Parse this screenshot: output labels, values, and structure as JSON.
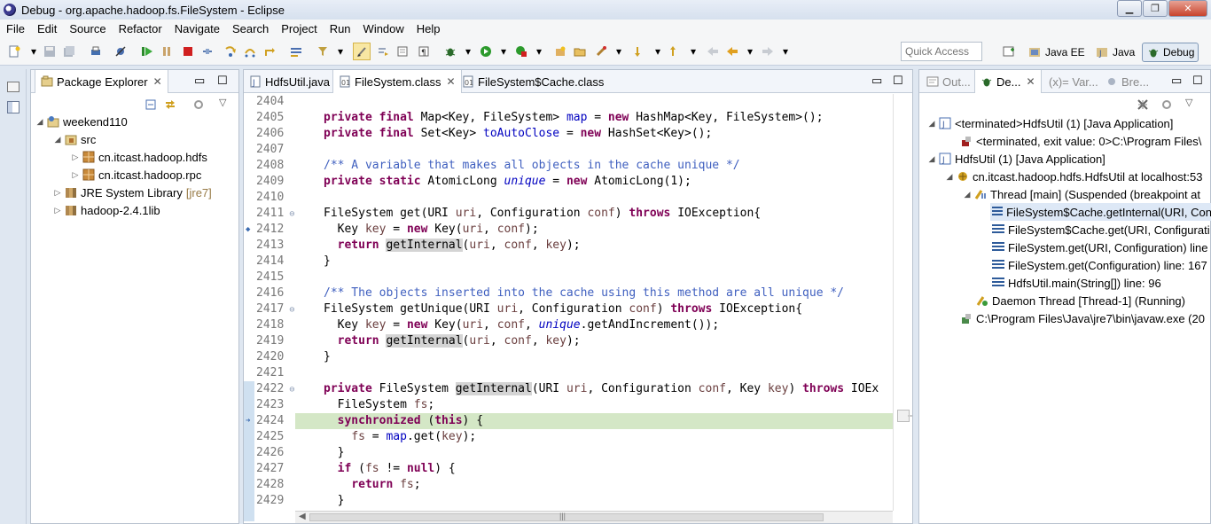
{
  "window": {
    "title": "Debug - org.apache.hadoop.fs.FileSystem - Eclipse",
    "minimize_glyph": "▁",
    "restore_glyph": "❐",
    "close_glyph": "✕"
  },
  "menu": [
    "File",
    "Edit",
    "Source",
    "Refactor",
    "Navigate",
    "Search",
    "Project",
    "Run",
    "Window",
    "Help"
  ],
  "toolbar": {
    "quick_access_placeholder": "Quick Access",
    "perspectives": [
      "Java EE",
      "Java",
      "Debug"
    ],
    "active_perspective": "Debug"
  },
  "package_explorer": {
    "tab_label": "Package Explorer",
    "tree": [
      {
        "label": "weekend110",
        "level": 0,
        "expanded": true
      },
      {
        "label": "src",
        "level": 1,
        "expanded": true
      },
      {
        "label": "cn.itcast.hadoop.hdfs",
        "level": 2,
        "expanded": false
      },
      {
        "label": "cn.itcast.hadoop.rpc",
        "level": 2,
        "expanded": false
      },
      {
        "label": "JRE System Library",
        "suffix": "[jre7]",
        "level": 1,
        "expanded": false
      },
      {
        "label": "hadoop-2.4.1lib",
        "level": 1,
        "expanded": false
      }
    ]
  },
  "editor": {
    "tabs": [
      {
        "label": "HdfsUtil.java",
        "active": false
      },
      {
        "label": "FileSystem.class",
        "active": true
      },
      {
        "label": "FileSystem$Cache.class",
        "active": false
      }
    ],
    "current_line": 2424,
    "lines": [
      {
        "n": "2404"
      },
      {
        "n": "2405"
      },
      {
        "n": "2406"
      },
      {
        "n": "2407"
      },
      {
        "n": "2408"
      },
      {
        "n": "2409"
      },
      {
        "n": "2410"
      },
      {
        "n": "2411",
        "fold": true
      },
      {
        "n": "2412",
        "marker": true
      },
      {
        "n": "2413"
      },
      {
        "n": "2414"
      },
      {
        "n": "2415"
      },
      {
        "n": "2416"
      },
      {
        "n": "2417",
        "fold": true
      },
      {
        "n": "2418"
      },
      {
        "n": "2419"
      },
      {
        "n": "2420"
      },
      {
        "n": "2421"
      },
      {
        "n": "2422",
        "fold": true
      },
      {
        "n": "2423"
      },
      {
        "n": "2424",
        "current": true
      },
      {
        "n": "2425"
      },
      {
        "n": "2426"
      },
      {
        "n": "2427"
      },
      {
        "n": "2428"
      },
      {
        "n": "2429"
      }
    ]
  },
  "right_panel": {
    "tabs": [
      "Out...",
      "De...",
      "(x)= Var...",
      "Bre..."
    ],
    "active_tab": "De...",
    "tree": [
      {
        "label": "<terminated>HdfsUtil (1) [Java Application]",
        "level": 0
      },
      {
        "label": "<terminated, exit value: 0>C:\\Program Files\\",
        "level": 1
      },
      {
        "label": "HdfsUtil (1) [Java Application]",
        "level": 0
      },
      {
        "label": "cn.itcast.hadoop.hdfs.HdfsUtil at localhost:53",
        "level": 1
      },
      {
        "label": "Thread [main] (Suspended (breakpoint at",
        "level": 2
      },
      {
        "label": "FileSystem$Cache.getInternal(URI, Con",
        "level": 3,
        "selected": true
      },
      {
        "label": "FileSystem$Cache.get(URI, Configurati",
        "level": 3
      },
      {
        "label": "FileSystem.get(URI, Configuration) line",
        "level": 3
      },
      {
        "label": "FileSystem.get(Configuration) line: 167",
        "level": 3
      },
      {
        "label": "HdfsUtil.main(String[]) line: 96",
        "level": 3
      },
      {
        "label": "Daemon Thread [Thread-1] (Running)",
        "level": 2
      },
      {
        "label": "C:\\Program Files\\Java\\jre7\\bin\\javaw.exe (20",
        "level": 1
      }
    ]
  },
  "colors": {
    "keyword": "#7f0055",
    "field": "#0000c0",
    "comment": "#3f5fbf",
    "current_line": "#d4e7c6"
  }
}
